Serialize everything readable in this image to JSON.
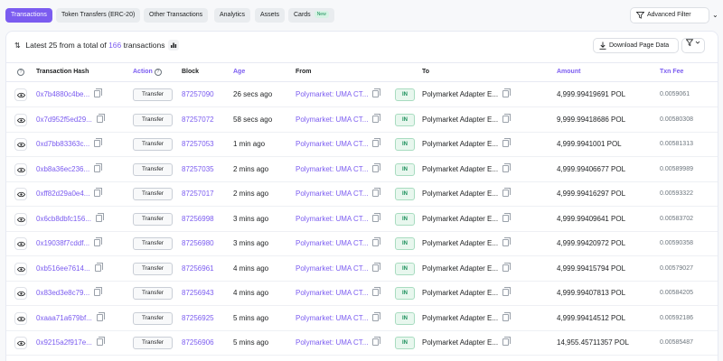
{
  "tabs": [
    {
      "label": "Transactions",
      "active": true
    },
    {
      "label": "Token Transfers (ERC-20)",
      "active": false
    },
    {
      "label": "Other Transactions",
      "active": false
    },
    {
      "label": "Analytics",
      "active": false
    },
    {
      "label": "Assets",
      "active": false
    },
    {
      "label": "Cards",
      "active": false,
      "badge": "New"
    }
  ],
  "advanced_filter": {
    "label": "Advanced Filter",
    "icon": "filter-icon"
  },
  "summary": {
    "prefix": "Latest 25 from a total of",
    "count": "166",
    "suffix": "transactions"
  },
  "download": {
    "label": "Download Page Data",
    "icon": "download-icon"
  },
  "columns": {
    "hash": "Transaction Hash",
    "action": "Action",
    "block": "Block",
    "age": "Age",
    "from": "From",
    "to": "To",
    "amount": "Amount",
    "fee": "Txn Fee"
  },
  "colors": {
    "accent": "#7b5cf0",
    "in_badge": "#1a8f5a"
  },
  "rows": [
    {
      "hash": "0x7b4880c4be...",
      "action": "Transfer",
      "block": "87257090",
      "age": "26 secs ago",
      "from": "Polymarket: UMA CT...",
      "dir": "IN",
      "to": "Polymarket Adapter E...",
      "amount": "4,999.99419691 POL",
      "fee": "0.0059061"
    },
    {
      "hash": "0x7d952f5ed29...",
      "action": "Transfer",
      "block": "87257072",
      "age": "58 secs ago",
      "from": "Polymarket: UMA CT...",
      "dir": "IN",
      "to": "Polymarket Adapter E...",
      "amount": "9,999.99418686 POL",
      "fee": "0.00580308"
    },
    {
      "hash": "0xd7bb83363c...",
      "action": "Transfer",
      "block": "87257053",
      "age": "1 min ago",
      "from": "Polymarket: UMA CT...",
      "dir": "IN",
      "to": "Polymarket Adapter E...",
      "amount": "4,999.9941001 POL",
      "fee": "0.00581313"
    },
    {
      "hash": "0xb8a36ec236...",
      "action": "Transfer",
      "block": "87257035",
      "age": "2 mins ago",
      "from": "Polymarket: UMA CT...",
      "dir": "IN",
      "to": "Polymarket Adapter E...",
      "amount": "4,999.99406677 POL",
      "fee": "0.00589989"
    },
    {
      "hash": "0xff82d29a0e4...",
      "action": "Transfer",
      "block": "87257017",
      "age": "2 mins ago",
      "from": "Polymarket: UMA CT...",
      "dir": "IN",
      "to": "Polymarket Adapter E...",
      "amount": "4,999.99416297 POL",
      "fee": "0.00593322"
    },
    {
      "hash": "0x6cb8dbfc156...",
      "action": "Transfer",
      "block": "87256998",
      "age": "3 mins ago",
      "from": "Polymarket: UMA CT...",
      "dir": "IN",
      "to": "Polymarket Adapter E...",
      "amount": "4,999.99409641 POL",
      "fee": "0.00583702"
    },
    {
      "hash": "0x19038f7cddf...",
      "action": "Transfer",
      "block": "87256980",
      "age": "3 mins ago",
      "from": "Polymarket: UMA CT...",
      "dir": "IN",
      "to": "Polymarket Adapter E...",
      "amount": "4,999.99420972 POL",
      "fee": "0.00590358"
    },
    {
      "hash": "0xb516ee7614...",
      "action": "Transfer",
      "block": "87256961",
      "age": "4 mins ago",
      "from": "Polymarket: UMA CT...",
      "dir": "IN",
      "to": "Polymarket Adapter E...",
      "amount": "4,999.99415794 POL",
      "fee": "0.00579027"
    },
    {
      "hash": "0x83ed3e8c79...",
      "action": "Transfer",
      "block": "87256943",
      "age": "4 mins ago",
      "from": "Polymarket: UMA CT...",
      "dir": "IN",
      "to": "Polymarket Adapter E...",
      "amount": "4,999.99407813 POL",
      "fee": "0.00584205"
    },
    {
      "hash": "0xaaa71a679bf...",
      "action": "Transfer",
      "block": "87256925",
      "age": "5 mins ago",
      "from": "Polymarket: UMA CT...",
      "dir": "IN",
      "to": "Polymarket Adapter E...",
      "amount": "4,999.99414512 POL",
      "fee": "0.00592186"
    },
    {
      "hash": "0x9215a2f917e...",
      "action": "Transfer",
      "block": "87256906",
      "age": "5 mins ago",
      "from": "Polymarket: UMA CT...",
      "dir": "IN",
      "to": "Polymarket Adapter E...",
      "amount": "14,955.45711357 POL",
      "fee": "0.00585487"
    }
  ]
}
